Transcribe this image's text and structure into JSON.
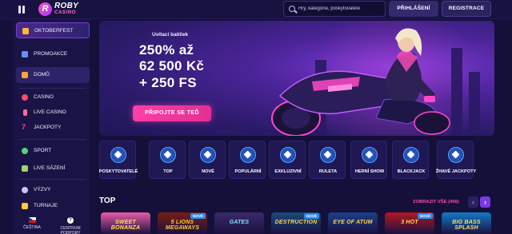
{
  "header": {
    "logo": {
      "title": "ROBY",
      "subtitle": "CASINO"
    },
    "search_placeholder": "Hry, kategorie, poskytovatelé",
    "login_label": "PŘIHLÁŠENÍ",
    "register_label": "REGISTRACE"
  },
  "sidebar": {
    "items": [
      {
        "label": "OKTOBERFEST",
        "icon": "beer-mug-icon"
      },
      {
        "label": "PROMOAKCE",
        "icon": "gift-icon"
      },
      {
        "label": "DOMŮ",
        "icon": "home-icon"
      },
      {
        "label": "CASINO",
        "icon": "cherries-icon"
      },
      {
        "label": "LIVE CASINO",
        "icon": "microphone-icon"
      },
      {
        "label": "JACKPOTY",
        "icon": "seven-icon"
      },
      {
        "label": "SPORT",
        "icon": "soccer-ball-icon"
      },
      {
        "label": "LIVE SÁZENÍ",
        "icon": "live-bet-icon"
      },
      {
        "label": "VÝZVY",
        "icon": "target-icon"
      },
      {
        "label": "TURNAJE",
        "icon": "trophy-icon"
      }
    ],
    "language_label": "ČEŠTINA",
    "support_label": "CENTRUM PODPORY"
  },
  "hero": {
    "subtitle": "Uvítací balíček",
    "line1": "250% až",
    "line2": "62 500 Kč",
    "line3": "+ 250 FS",
    "cta_label": "PŘIPOJTE SE TEĎ"
  },
  "categories": [
    {
      "label": "POSKYTOVATELÉ",
      "icon": "provider-icon"
    },
    {
      "label": "TOP",
      "icon": "medal-icon"
    },
    {
      "label": "NOVÉ",
      "icon": "sparkle-icon"
    },
    {
      "label": "POPULÁRNÍ",
      "icon": "star-icon"
    },
    {
      "label": "EXKLUZIVNÍ",
      "icon": "diamond-icon"
    },
    {
      "label": "RULETA",
      "icon": "roulette-icon"
    },
    {
      "label": "HERNÍ SHOW",
      "icon": "game-show-icon"
    },
    {
      "label": "BLACKJACK",
      "icon": "spade-icon"
    },
    {
      "label": "ŽHAVÉ JACKPOTY",
      "icon": "flame-icon"
    }
  ],
  "top_section": {
    "title": "TOP",
    "show_all_label": "ZOBRAZIT VŠE (456)",
    "prev_label": "‹",
    "next_label": "›"
  },
  "games": [
    {
      "name": "SWEET BONANZA",
      "badge": "",
      "bg": "#e85aa8",
      "fg": "#ffe34a"
    },
    {
      "name": "5 LIONS MEGAWAYS",
      "badge": "NOVÉ",
      "bg": "#7a1c12",
      "fg": "#ffcf3a"
    },
    {
      "name": "GATES",
      "badge": "",
      "bg": "#3a2a6c",
      "fg": "#7fe0ff"
    },
    {
      "name": "DESTRUCTION",
      "badge": "NOVÉ",
      "bg": "#1a4a7a",
      "fg": "#ffd24a"
    },
    {
      "name": "EYE OF ATUM",
      "badge": "",
      "bg": "#1d3f8a",
      "fg": "#ffd34a"
    },
    {
      "name": "3 HOT",
      "badge": "NOVÉ",
      "bg": "#b5161f",
      "fg": "#ffe04a"
    },
    {
      "name": "BIG BASS SPLASH",
      "badge": "",
      "bg": "#1479c7",
      "fg": "#ffe14a"
    }
  ]
}
